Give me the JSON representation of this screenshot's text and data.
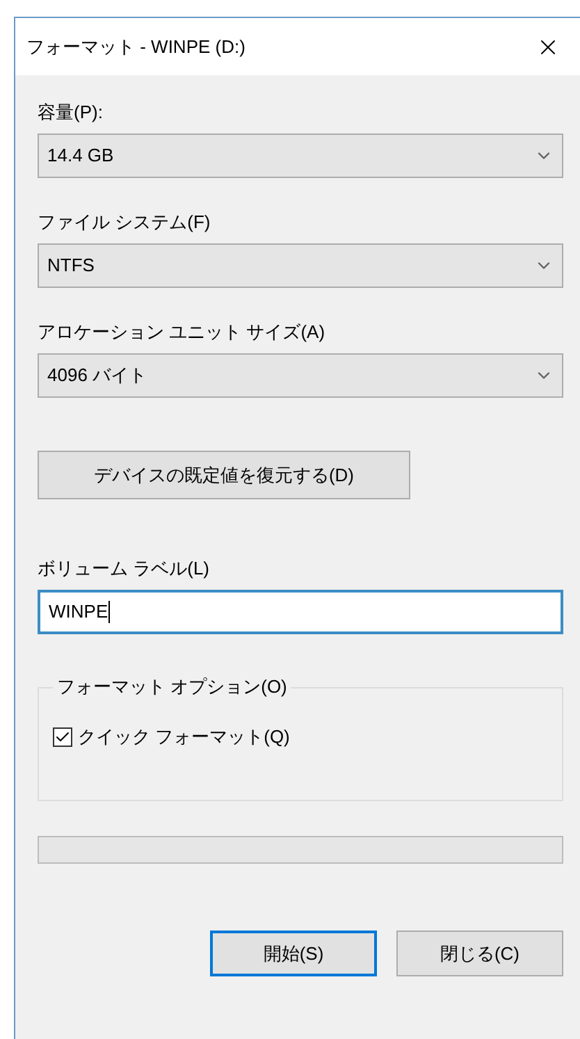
{
  "window": {
    "title": "フォーマット - WINPE (D:)"
  },
  "fields": [
    {
      "kind": "dropdown",
      "label": "容量(P):",
      "value": "14.4 GB"
    },
    {
      "kind": "dropdown",
      "label": "ファイル システム(F)",
      "value": "NTFS"
    },
    {
      "kind": "dropdown",
      "label": "アロケーション ユニット サイズ(A)",
      "value": "4096 バイト"
    }
  ],
  "restore_button": "デバイスの既定値を復元する(D)",
  "volume_label": {
    "label": "ボリューム ラベル(L)",
    "value": "WINPE",
    "focused": true
  },
  "format_options": {
    "title": "フォーマット オプション(O)",
    "options": [
      {
        "label": "クイック フォーマット(Q)",
        "checked": true
      }
    ]
  },
  "progress": {
    "level": 0
  },
  "buttons": [
    {
      "label": "開始(S)",
      "default": true
    },
    {
      "label": "閉じる(C)",
      "default": false
    }
  ]
}
